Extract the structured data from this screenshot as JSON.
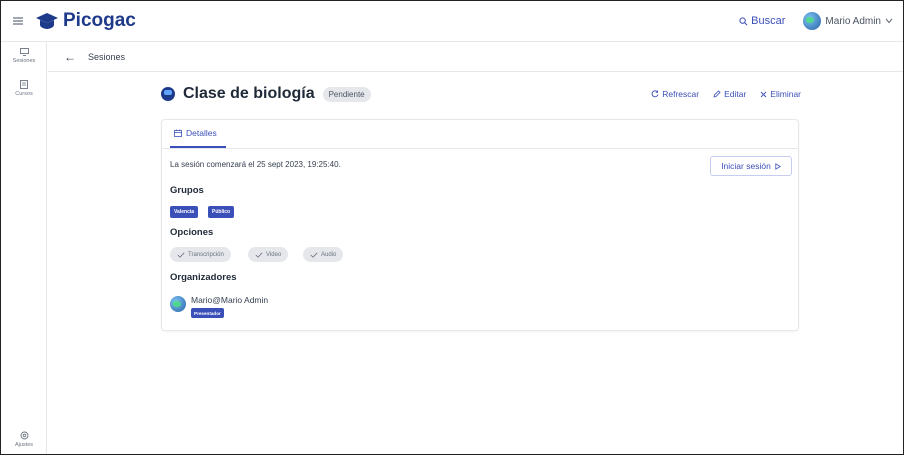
{
  "app": {
    "name": "Picogac",
    "brand_color": "#1e3a8a",
    "accent_color": "#3b4fb8"
  },
  "topbar": {
    "menu_icon": "hamburger-icon",
    "search_label": "Buscar",
    "user_name": "Mario Admin"
  },
  "rail": {
    "items": [
      {
        "label": "Sesiones",
        "icon": "monitor-icon"
      },
      {
        "label": "Cursos",
        "icon": "book-icon"
      }
    ],
    "bottom": {
      "label": "Ajustes",
      "icon": "gear-icon"
    }
  },
  "breadcrumb": {
    "back_label": "Sesiones"
  },
  "session": {
    "title": "Clase de biología",
    "status": "Pendiente"
  },
  "actions": {
    "refresh": "Refrescar",
    "edit": "Editar",
    "delete": "Eliminar"
  },
  "tabs": {
    "details": "Detalles"
  },
  "details": {
    "start_text": "La sesión comenzará el 25 sept 2023, 19:25:40.",
    "start_button": "Iniciar sesión",
    "groups_heading": "Grupos",
    "groups": [
      "Valencia",
      "Público"
    ],
    "options_heading": "Opciones",
    "options": [
      "Transcripción",
      "Video",
      "Audio"
    ],
    "organizers_heading": "Organizadores",
    "organizer": {
      "name": "Mario@Mario Admin",
      "role": "Presentador"
    }
  }
}
